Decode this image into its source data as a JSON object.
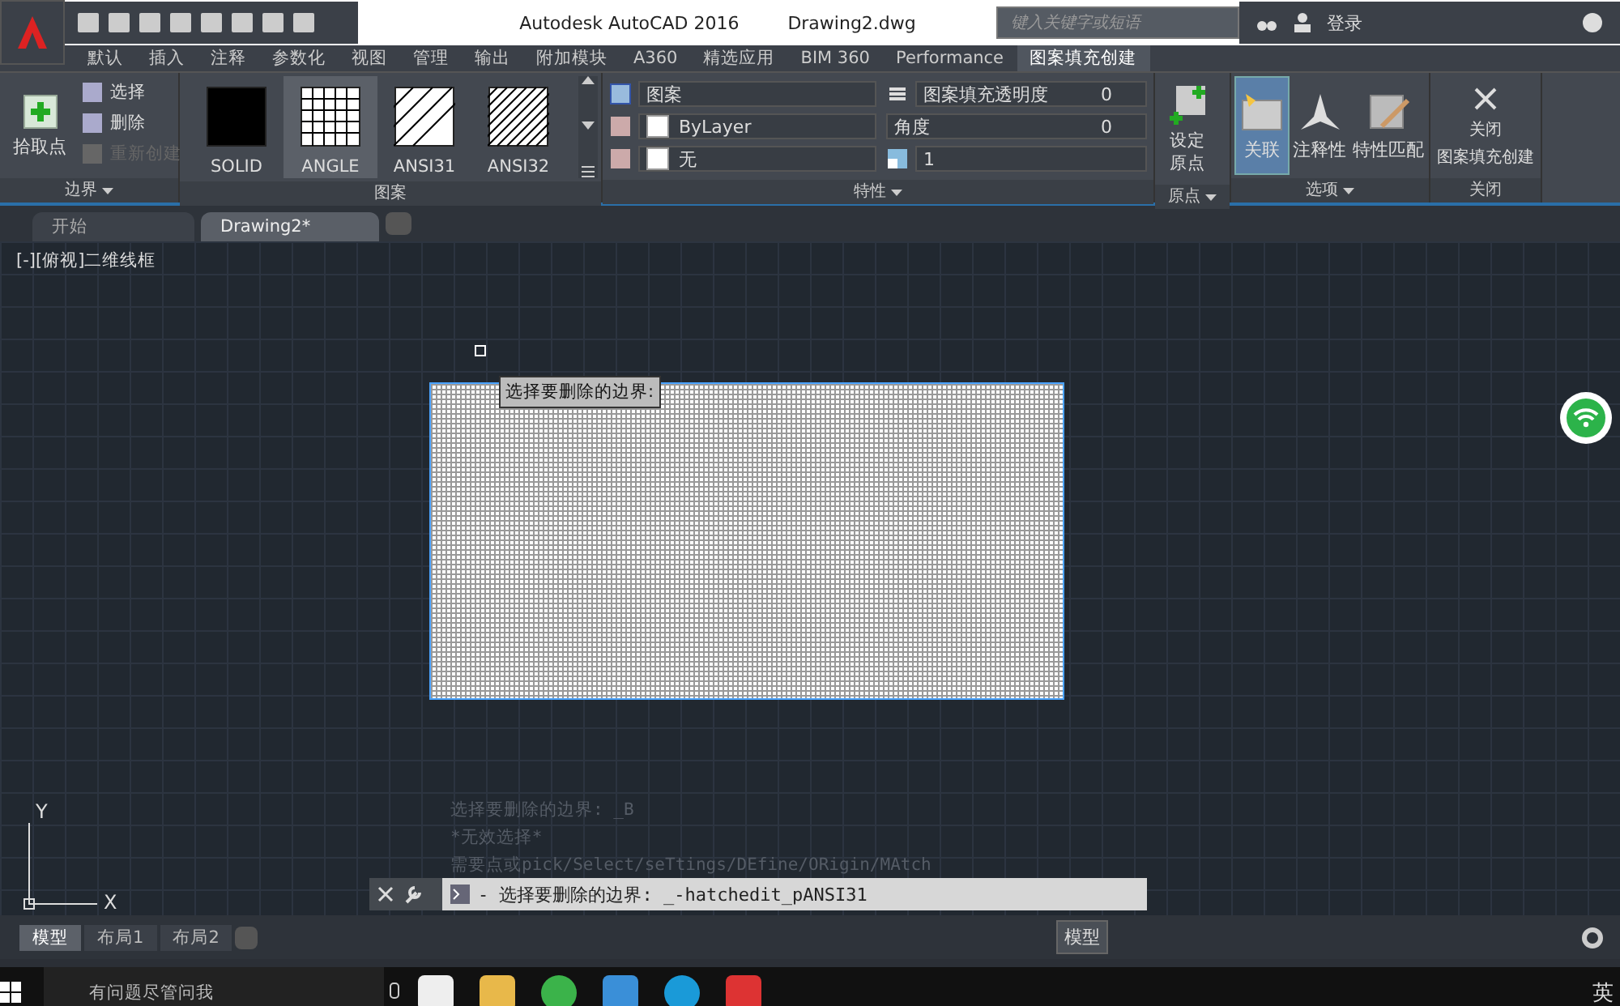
{
  "title_bar": {
    "app_title": "Autodesk AutoCAD 2016",
    "file_name": "Drawing2.dwg",
    "search_placeholder": "键入关键字或短语",
    "login": "登录"
  },
  "ribbon_tabs": [
    {
      "label": "默认",
      "selected": false
    },
    {
      "label": "插入",
      "selected": false
    },
    {
      "label": "注释",
      "selected": false
    },
    {
      "label": "参数化",
      "selected": false
    },
    {
      "label": "视图",
      "selected": false
    },
    {
      "label": "管理",
      "selected": false
    },
    {
      "label": "输出",
      "selected": false
    },
    {
      "label": "附加模块",
      "selected": false
    },
    {
      "label": "A360",
      "selected": false
    },
    {
      "label": "精选应用",
      "selected": false
    },
    {
      "label": "BIM 360",
      "selected": false
    },
    {
      "label": "Performance",
      "selected": false
    },
    {
      "label": "图案填充创建",
      "selected": true
    }
  ],
  "boundary_panel": {
    "pick_button": "拾取点",
    "actions": [
      {
        "label": "选择",
        "disabled": false
      },
      {
        "label": "删除",
        "disabled": false
      },
      {
        "label": "重新创建",
        "disabled": true
      }
    ],
    "title": "边界"
  },
  "pattern_panel": {
    "patterns": [
      {
        "label": "SOLID",
        "kind": "solid",
        "selected": false
      },
      {
        "label": "ANGLE",
        "kind": "grid",
        "selected": true
      },
      {
        "label": "ANSI31",
        "kind": "hatch",
        "selected": false
      },
      {
        "label": "ANSI32",
        "kind": "dense",
        "selected": false
      }
    ],
    "title": "图案"
  },
  "properties_panel": {
    "type": "图案",
    "layer_color": "ByLayer",
    "background": "无",
    "transparency_label": "图案填充透明度",
    "transparency": "0",
    "angle_label": "角度",
    "angle": "0",
    "scale": "1",
    "title": "特性"
  },
  "origin_panel": {
    "button": "设定原点",
    "title": "原点"
  },
  "options_panel": {
    "buttons": [
      {
        "label": "关联",
        "kind": "associative",
        "selected": true
      },
      {
        "label": "注释性",
        "kind": "annotative",
        "selected": false
      },
      {
        "label": "特性匹配",
        "kind": "match",
        "selected": false
      }
    ],
    "title": "选项"
  },
  "close_panel": {
    "button_lines": [
      "关闭",
      "图案填充创建"
    ],
    "title": "关闭"
  },
  "doc_tabs": [
    {
      "label": "开始",
      "selected": false
    },
    {
      "label": "Drawing2*",
      "selected": true
    }
  ],
  "viewport_label": "[-][俯视]二维线框",
  "tooltip": "选择要删除的边界:",
  "axes": {
    "x": "X",
    "y": "Y"
  },
  "command_history": [
    "选择要删除的边界: _B",
    "*无效选择*",
    "需要点或pick/Select/seTtings/DEfine/ORigin/MAtch"
  ],
  "command_line": "- 选择要删除的边界: _-hatchedit_pANSI31",
  "layout_tabs": [
    {
      "label": "模型",
      "selected": true
    },
    {
      "label": "布局1",
      "selected": false
    },
    {
      "label": "布局2",
      "selected": false
    }
  ],
  "status_bar": {
    "model": "模型"
  },
  "taskbar": {
    "search_placeholder": "有问题尽管问我",
    "ime": "英"
  }
}
